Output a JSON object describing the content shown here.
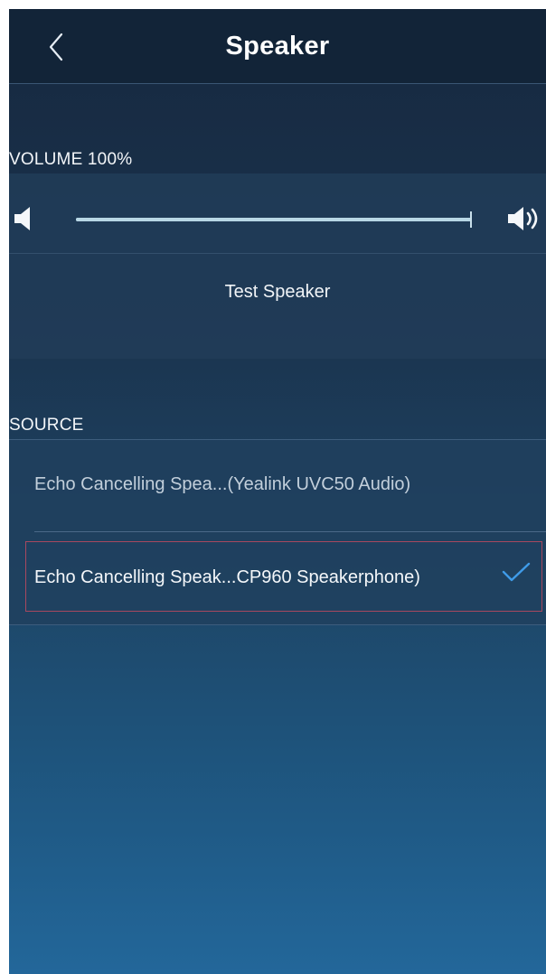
{
  "header": {
    "title": "Speaker",
    "back_icon": "chevron-left-icon"
  },
  "volume": {
    "label": "VOLUME 100%",
    "level_percent": 100,
    "min_icon": "speaker-mute-icon",
    "max_icon": "speaker-loud-icon",
    "test_button_label": "Test Speaker"
  },
  "source": {
    "label": "SOURCE",
    "items": [
      {
        "label": "Echo Cancelling Spea...(Yealink UVC50 Audio)",
        "selected": false
      },
      {
        "label": "Echo Cancelling Speak...CP960 Speakerphone)",
        "selected": true
      }
    ],
    "selected_icon": "checkmark-icon"
  },
  "colors": {
    "header_bg": "#122438",
    "accent_check": "#3f9be8",
    "selection_outline": "#a8485f"
  }
}
